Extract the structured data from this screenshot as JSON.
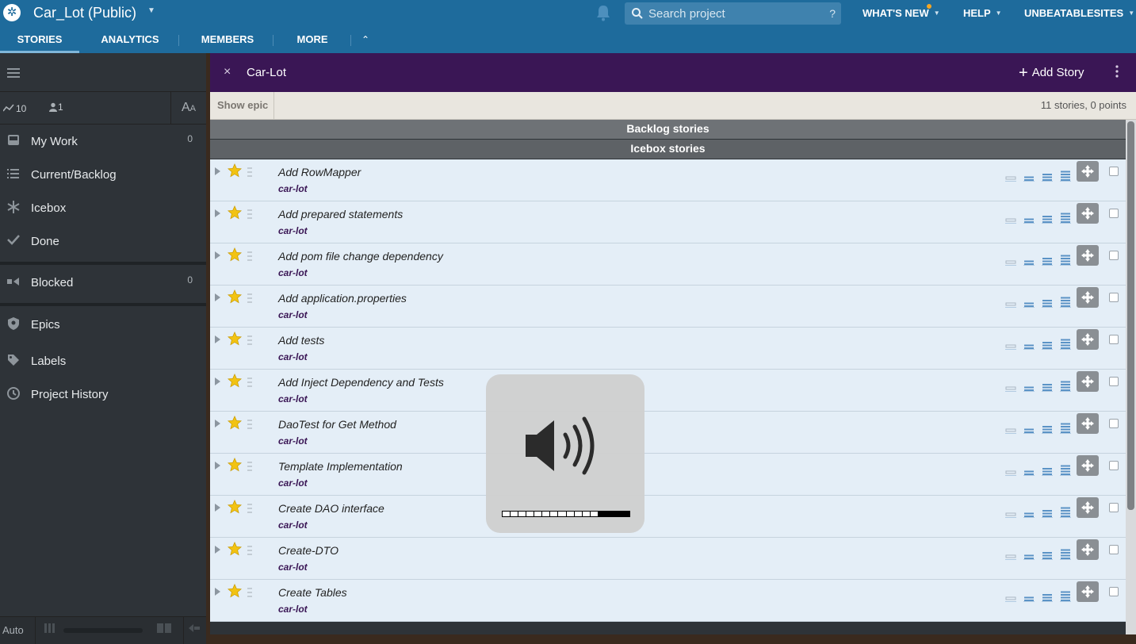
{
  "app": {
    "project_title": "Car_Lot (Public)",
    "search_placeholder": "Search project",
    "search_help": "?",
    "nav_right": [
      "WHAT'S NEW",
      "HELP",
      "UNBEATABLESITES"
    ],
    "tabs": [
      "STORIES",
      "ANALYTICS",
      "MEMBERS",
      "MORE"
    ],
    "active_tab": "STORIES",
    "colors": {
      "header": "#1e6b9c",
      "panel_header": "#3a1655",
      "story_bg": "#e4eef7",
      "star": "#f2c313"
    }
  },
  "sidebar": {
    "velocity": "10",
    "members": "1",
    "font_toggle_big": "A",
    "font_toggle_small": "A",
    "items": [
      {
        "label": "My Work",
        "count": "0",
        "icon": "inbox-icon"
      },
      {
        "label": "Current/Backlog",
        "count": "",
        "icon": "list-icon"
      },
      {
        "label": "Icebox",
        "count": "",
        "icon": "snowflake-icon"
      },
      {
        "label": "Done",
        "count": "",
        "icon": "checkmark-icon"
      },
      {
        "label": "Blocked",
        "count": "0",
        "icon": "blocked-icon"
      },
      {
        "label": "Epics",
        "count": "",
        "icon": "shield-icon"
      },
      {
        "label": "Labels",
        "count": "",
        "icon": "tag-icon"
      },
      {
        "label": "Project History",
        "count": "",
        "icon": "clock-icon"
      }
    ],
    "bottom_mode": "Auto"
  },
  "panel": {
    "close": "×",
    "title": "Car-Lot",
    "add_story": "Add Story",
    "show_epic": "Show epic",
    "summary": "11 stories, 0 points",
    "sections": [
      "Backlog stories",
      "Icebox stories"
    ],
    "stories": [
      {
        "name": "Add RowMapper",
        "label": "car-lot"
      },
      {
        "name": "Add prepared statements",
        "label": "car-lot"
      },
      {
        "name": "Add pom file change dependency",
        "label": "car-lot"
      },
      {
        "name": "Add application.properties",
        "label": "car-lot"
      },
      {
        "name": "Add tests",
        "label": "car-lot"
      },
      {
        "name": "Add Inject Dependency and Tests",
        "label": "car-lot"
      },
      {
        "name": "DaoTest for Get Method",
        "label": "car-lot"
      },
      {
        "name": "Template Implementation",
        "label": "car-lot"
      },
      {
        "name": "Create DAO interface",
        "label": "car-lot"
      },
      {
        "name": "Create-DTO",
        "label": "car-lot"
      },
      {
        "name": "Create Tables",
        "label": "car-lot"
      }
    ]
  },
  "volume_hud": {
    "icon": "speaker-volume-icon",
    "level": 0.75,
    "segments": 16
  }
}
